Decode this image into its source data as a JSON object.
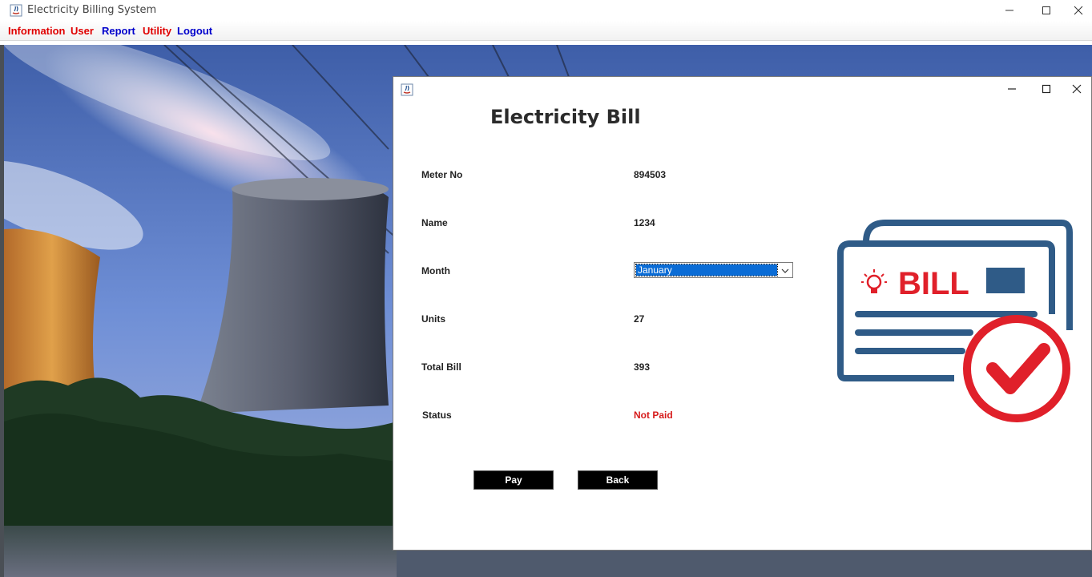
{
  "window": {
    "title": "Electricity Billing System"
  },
  "menu": {
    "items": [
      {
        "label": "Information",
        "color": "#e00000"
      },
      {
        "label": "User",
        "color": "#e00000"
      },
      {
        "label": "Report",
        "color": "#0000cc"
      },
      {
        "label": "Utility",
        "color": "#e00000"
      },
      {
        "label": "Logout",
        "color": "#0000cc"
      }
    ]
  },
  "dialog": {
    "heading": "Electricity Bill",
    "fields": {
      "meter_label": "Meter No",
      "meter_value": "894503",
      "name_label": "Name",
      "name_value": "1234",
      "month_label": "Month",
      "month_selected": "January",
      "units_label": "Units",
      "units_value": "27",
      "total_label": "Total Bill",
      "total_value": "393",
      "status_label": "Status",
      "status_value": "Not Paid"
    },
    "buttons": {
      "pay": "Pay",
      "back": "Back"
    },
    "graphic": {
      "text": "BILL",
      "icon": "bill-check-icon",
      "colors": {
        "primary": "#2f5b87",
        "accent": "#e0202a"
      }
    }
  }
}
